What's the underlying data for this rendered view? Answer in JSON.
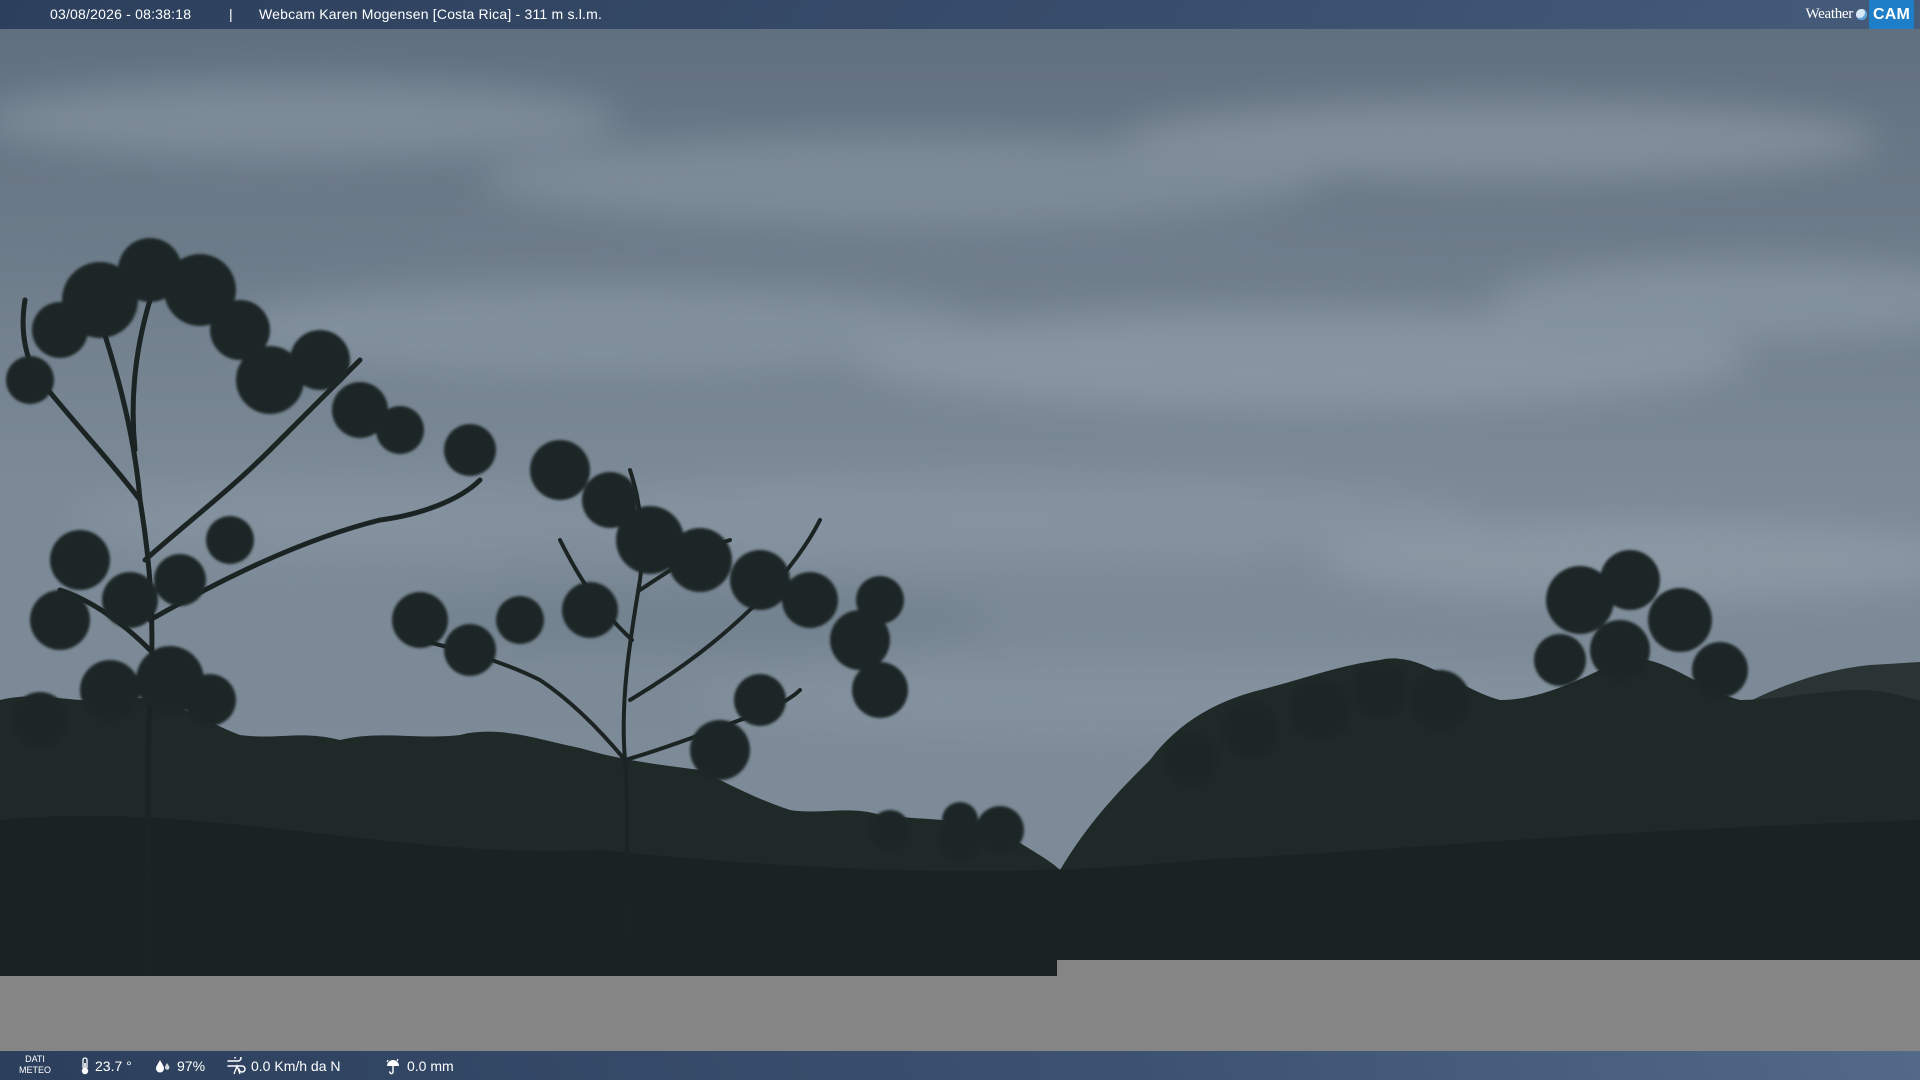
{
  "top_bar": {
    "timestamp": "03/08/2026 - 08:38:18",
    "separator": "|",
    "title": "Webcam Karen Mogensen [Costa Rica]  - 311 m s.l.m.",
    "logo_word": "Weather",
    "logo_cam": "CAM"
  },
  "bottom_bar": {
    "label_line1": "DATI",
    "label_line2": "METEO",
    "temperature": "23.7 °",
    "humidity": "97%",
    "wind": "0.0 Km/h da N",
    "rain": "0.0 mm",
    "icons": [
      "thermometer-icon",
      "humidity-icon",
      "wind-icon",
      "rain-icon"
    ]
  },
  "colors": {
    "bar": "#2f4a6e",
    "grey_block": "#858585",
    "logo_accent": "#1e7fc8"
  }
}
